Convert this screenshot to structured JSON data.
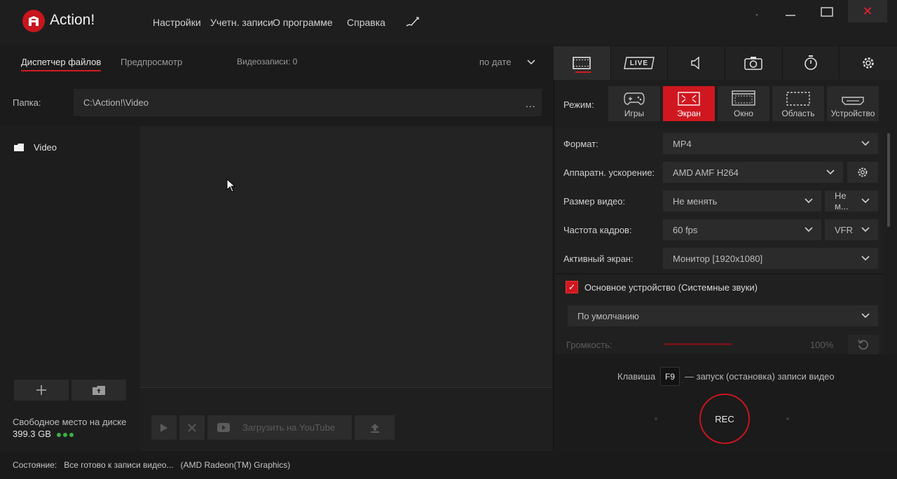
{
  "app": {
    "title": "Action!"
  },
  "menu": [
    "Настройки",
    "Учетн. записи",
    "О программе",
    "Справка"
  ],
  "window": {
    "minimize": "-",
    "close": "✕"
  },
  "left": {
    "tabs": [
      "Диспетчер файлов",
      "Предпросмотр"
    ],
    "recordings_count": "Видеозаписи: 0",
    "sort": "по дате",
    "folder_label": "Папка:",
    "folder_path": "C:\\Action!\\Video",
    "folder_more": "...",
    "tree": [
      {
        "label": "Video"
      }
    ],
    "disk_label": "Свободное место на диске",
    "disk_value": "399.3 GB",
    "upload_youtube": "Загрузить на YouTube"
  },
  "status": {
    "label": "Состояние:",
    "text": "Все готово к записи видео...",
    "gpu": "(AMD Radeon(TM) Graphics)"
  },
  "right": {
    "tab_live": "LIVE",
    "mode_label": "Режим:",
    "modes": [
      "Игры",
      "Экран",
      "Окно",
      "Область",
      "Устройство"
    ],
    "active_mode": "Экран",
    "settings": {
      "format_label": "Формат:",
      "format_value": "MP4",
      "hw_label": "Аппаратн. ускорение:",
      "hw_value": "AMD AMF H264",
      "size_label": "Размер видео:",
      "size_value": "Не менять",
      "size_value2": "Не м...",
      "fps_label": "Частота кадров:",
      "fps_value": "60 fps",
      "fps_mode": "VFR",
      "screen_label": "Активный экран:",
      "screen_value": "Монитор [1920x1080]",
      "audio_device": "Основное устройство (Системные звуки)",
      "audio_default": "По умолчанию",
      "volume_label": "Громкость:",
      "volume_value": "100%"
    },
    "hotkey_pre": "Клавиша",
    "hotkey_key": "F9",
    "hotkey_post": "— запуск (остановка) записи видео",
    "rec_label": "REC"
  },
  "colors": {
    "accent": "#d0171f",
    "bg": "#1b1b1b",
    "panel": "#2b2b2b",
    "disk_ok": "#3cb043"
  }
}
